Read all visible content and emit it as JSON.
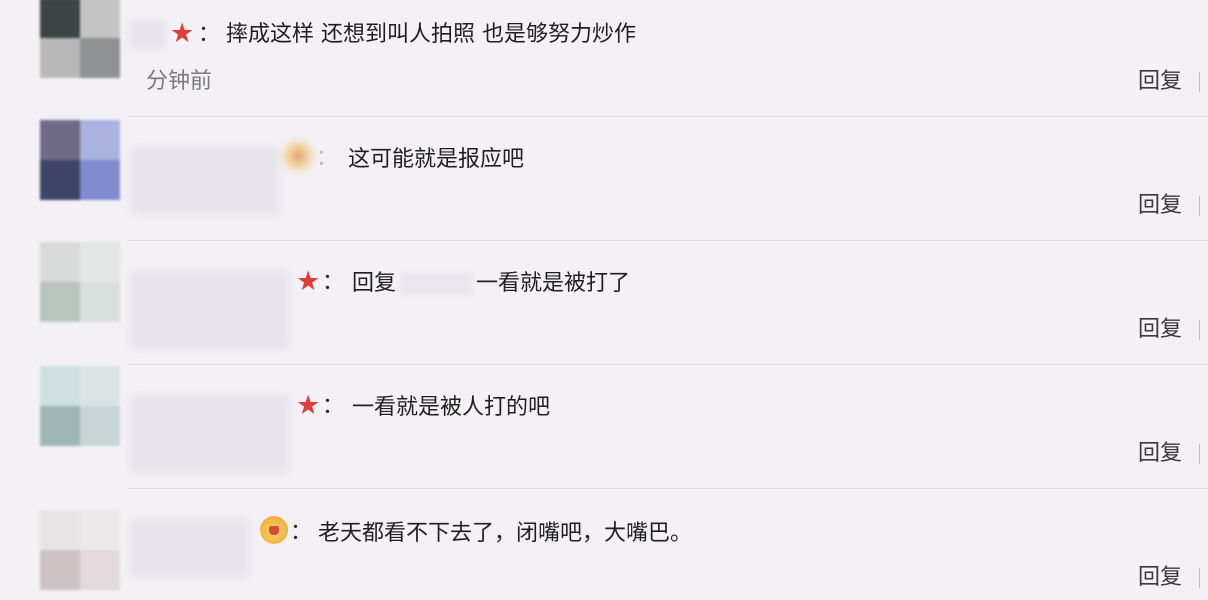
{
  "comments": [
    {
      "text": "摔成这样 还想到叫人拍照 也是够努力炒作",
      "time": "分钟前",
      "reply_label": "回复",
      "badge": "star-icon",
      "avatar_colors": [
        "#3c4446",
        "#c4c4c4",
        "#b8b8b8",
        "#8e9292"
      ]
    },
    {
      "text": "这可能就是报应吧",
      "reply_label": "回复",
      "badge": "blurred-badge",
      "avatar_colors": [
        "#6f6a86",
        "#a9b2e0",
        "#3f4466",
        "#7f8cd0"
      ]
    },
    {
      "reply_prefix": "回复",
      "text": "一看就是被打了",
      "reply_label": "回复",
      "badge": "star-icon",
      "avatar_colors": [
        "#d6dad9",
        "#e4e6e6",
        "#b9c4bf",
        "#d9dfdc"
      ]
    },
    {
      "text": "一看就是被人打的吧",
      "reply_label": "回复",
      "badge": "star-icon",
      "avatar_colors": [
        "#cfe0e2",
        "#dbe3e5",
        "#9eb7b6",
        "#c7d5d6"
      ]
    },
    {
      "text": "老天都看不下去了，闭嘴吧，大嘴巴。",
      "reply_label": "回复",
      "badge": "crown-icon",
      "avatar_colors": [
        "#e8e4e6",
        "#ece8ea",
        "#cfc2c5",
        "#e3d9dc"
      ]
    }
  ]
}
